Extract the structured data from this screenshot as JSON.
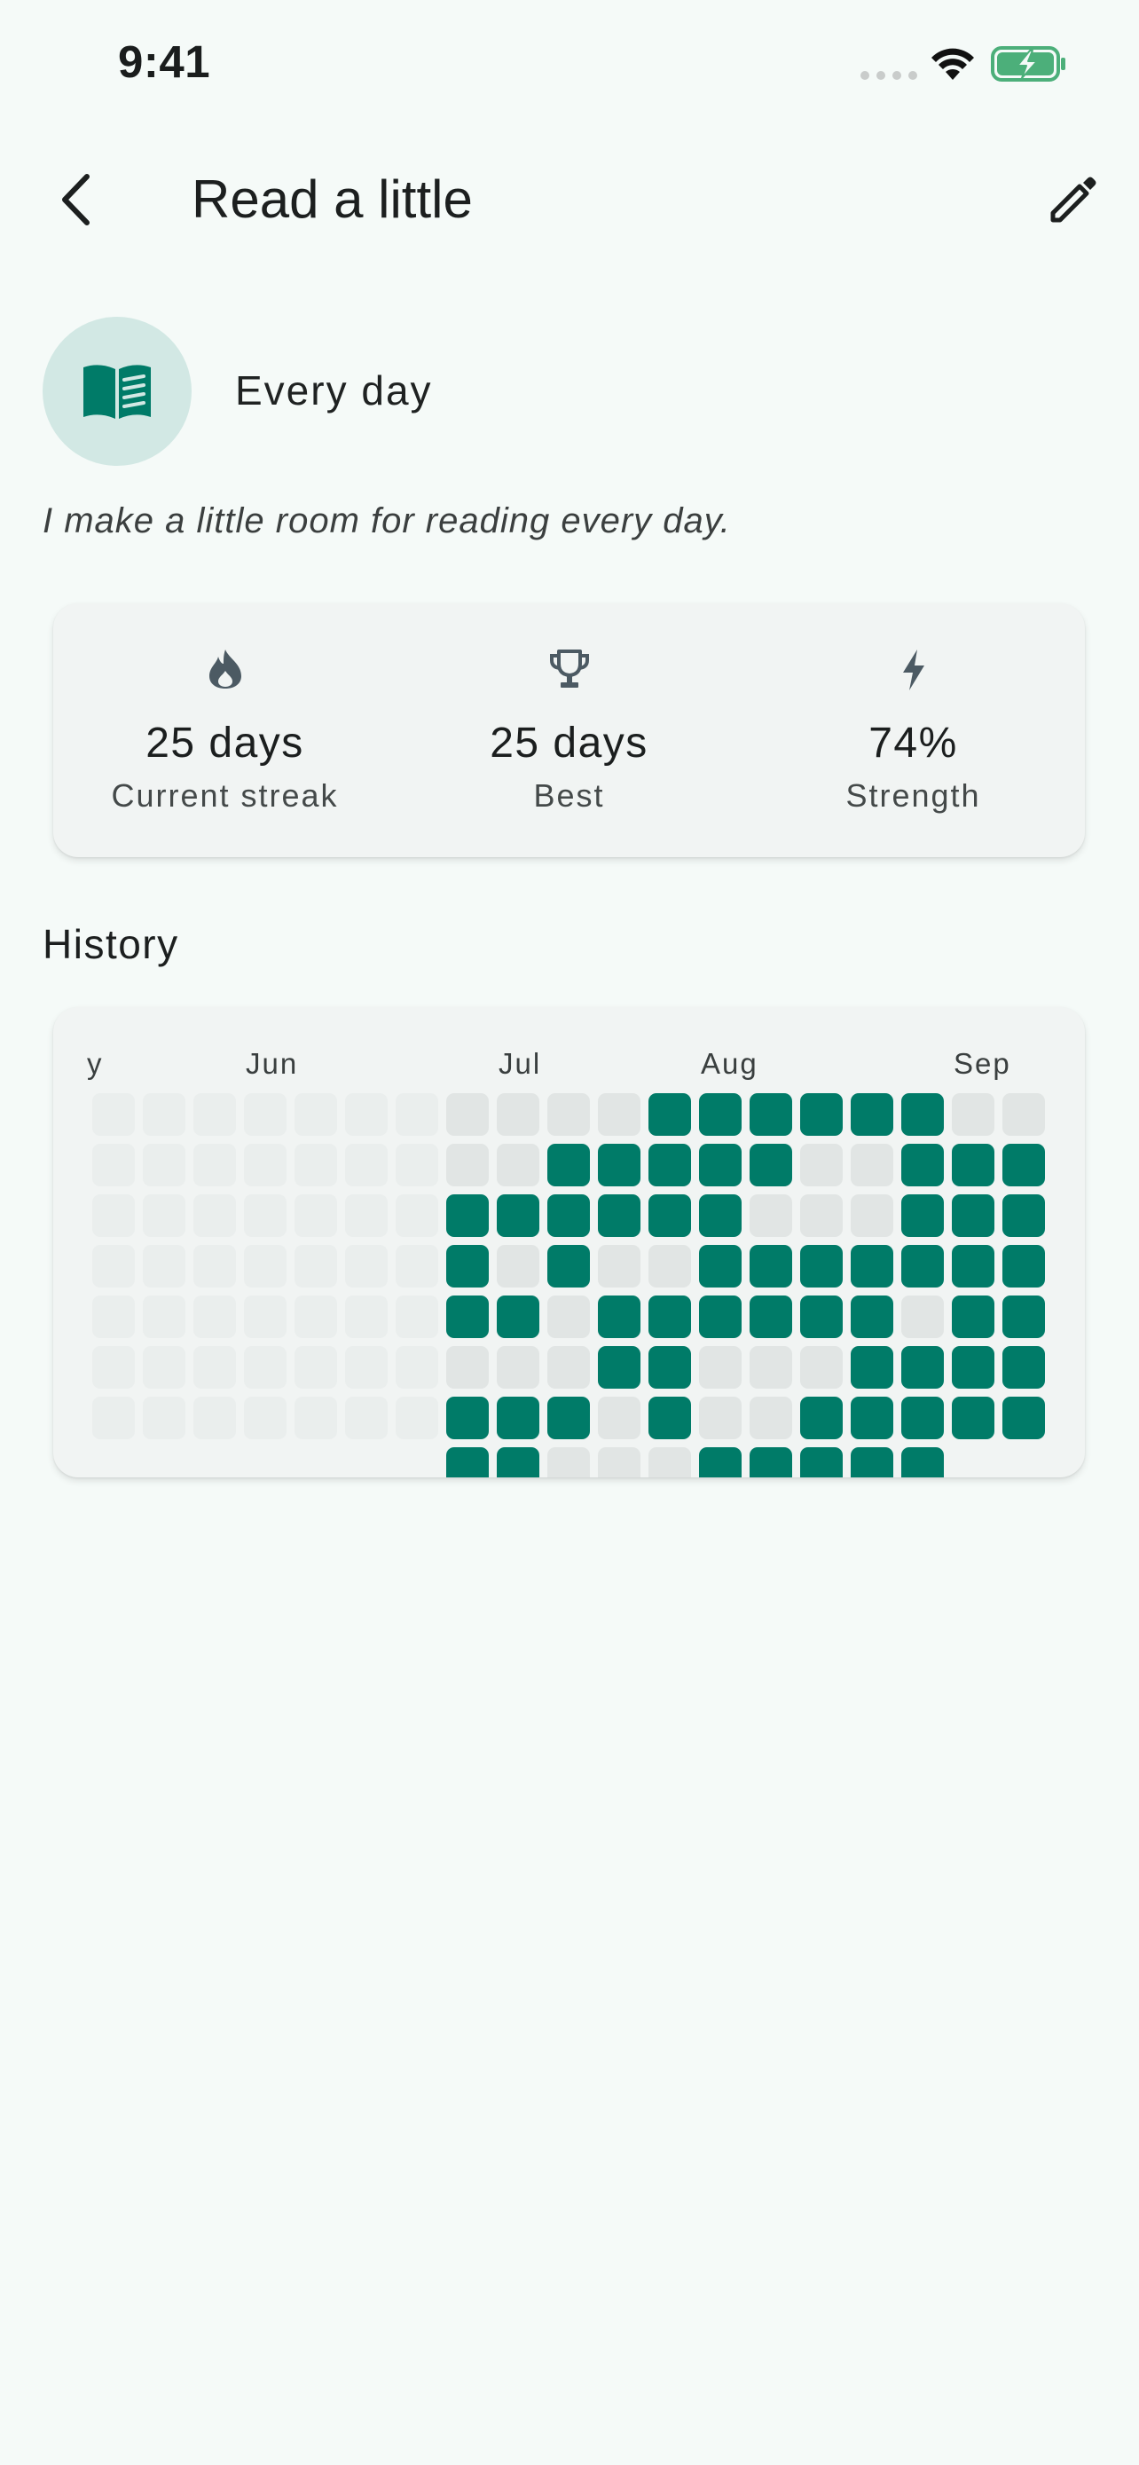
{
  "status_bar": {
    "time": "9:41"
  },
  "app_bar": {
    "title": "Read a little",
    "back_icon": "chevron-left-icon",
    "edit_icon": "pencil-icon"
  },
  "habit": {
    "icon": "open-book-icon",
    "frequency": "Every day",
    "description": "I make a little room for reading every day."
  },
  "stats": [
    {
      "icon": "flame-icon",
      "value": "25 days",
      "label": "Current streak"
    },
    {
      "icon": "trophy-icon",
      "value": "25 days",
      "label": "Best"
    },
    {
      "icon": "lightning-icon",
      "value": "74%",
      "label": "Strength"
    }
  ],
  "history": {
    "title": "History",
    "months": [
      "y",
      "Jun",
      "Jul",
      "Aug",
      "Sep"
    ],
    "legend_colors": {
      "done": "#007b68",
      "missed": "#e1e5e4",
      "outside": "#eaeeed"
    },
    "weeks": [
      "fffffff",
      "fffffff",
      "fffffff",
      "fffffff",
      "fffffff",
      "fffffff",
      "fffffff",
      "eedddedd",
      "eedededd",
      "edddeede",
      "eddeddee",
      "dddeddde",
      "dddddeed",
      "ddeddeed",
      "deeddedd",
      "deeddddd",
      "ddddeddd",
      "edddddd",
      "edddddd"
    ]
  },
  "colors": {
    "accent": "#007b68",
    "background": "#f5faf8",
    "card": "#f1f4f3",
    "icon_bg": "#d2e8e4"
  }
}
